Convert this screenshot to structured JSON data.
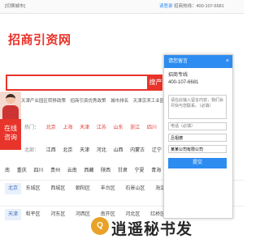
{
  "topbar": {
    "left": "[切换城市]",
    "login": "请登录",
    "hotline": "招商热线：400-107-6681"
  },
  "logo": "招商引资网",
  "search": {
    "placeholder": "",
    "button": "搜产"
  },
  "tags": [
    "天津产业园区转移政策",
    "招商引资优秀政策",
    "城市排名",
    "天津京滨工业园"
  ],
  "regions": {
    "hot_label": "热门：",
    "hot": [
      "北京",
      "上海",
      "天津",
      "江苏",
      "山东",
      "浙江",
      "四川",
      "新疆"
    ],
    "row2_label": "北部：",
    "row2": [
      "江西",
      "北京",
      "天津",
      "河北",
      "山西",
      "内蒙古",
      "辽宁",
      "吉林"
    ],
    "row3": [
      "南",
      "重庆",
      "四川",
      "贵州",
      "云南",
      "西藏",
      "陕西",
      "甘肃",
      "宁夏",
      "青海",
      "甘肃",
      "新疆"
    ]
  },
  "online": "在线咨询",
  "cities": [
    {
      "head": "北京",
      "items": [
        "东城区",
        "西城区",
        "朝阳区",
        "丰台区",
        "石景山区",
        "海淀区"
      ]
    },
    {
      "head": "天津",
      "items": [
        "和平区",
        "河东区",
        "河西区",
        "南开区",
        "河北区",
        "红桥区"
      ]
    }
  ],
  "popup": {
    "title": "请您留言",
    "close": "×",
    "hotline_label": "招商专线",
    "hotline": "400-107-6681",
    "message_placeholder": "请在此输入留言内容，我们会尽快与您联系。（必填）",
    "phone_placeholder": "电话（必填）",
    "name_value": "吕祖德",
    "company_value": "某某公司有限公司",
    "submit": "提交"
  },
  "watermark": "逍遥秘书发",
  "watermark_icon": "Q"
}
